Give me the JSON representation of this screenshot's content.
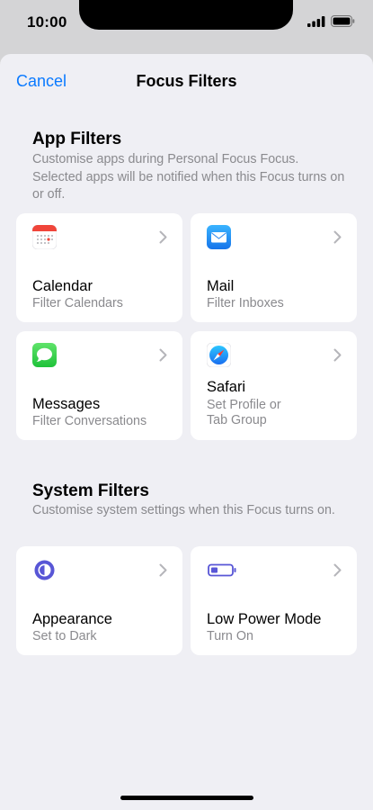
{
  "status": {
    "time": "10:00"
  },
  "nav": {
    "cancel_label": "Cancel",
    "title": "Focus Filters"
  },
  "app_filters": {
    "title": "App Filters",
    "description": "Customise apps during Personal Focus  Focus. Selected apps will be notified when this Focus turns on or off.",
    "cards": [
      {
        "title": "Calendar",
        "subtitle": "Filter Calendars",
        "icon": "calendar-icon"
      },
      {
        "title": "Mail",
        "subtitle": "Filter Inboxes",
        "icon": "mail-icon"
      },
      {
        "title": "Messages",
        "subtitle": "Filter Conversations",
        "icon": "messages-icon"
      },
      {
        "title": "Safari",
        "subtitle_line1": "Set Profile or",
        "subtitle_line2": "Tab Group",
        "icon": "safari-icon"
      }
    ]
  },
  "system_filters": {
    "title": "System Filters",
    "description": "Customise system settings when this Focus turns on.",
    "cards": [
      {
        "title": "Appearance",
        "subtitle": "Set to Dark",
        "icon": "appearance-icon"
      },
      {
        "title": "Low Power Mode",
        "subtitle": "Turn On",
        "icon": "battery-icon"
      }
    ]
  },
  "colors": {
    "accent": "#0a7aff",
    "background": "#efeff4",
    "secondary_text": "#8a8a8e",
    "mail_blue": "#1e8cf0",
    "messages_green": "#34c759",
    "appearance_indigo": "#5856d6",
    "calendar_red": "#f0453a"
  }
}
